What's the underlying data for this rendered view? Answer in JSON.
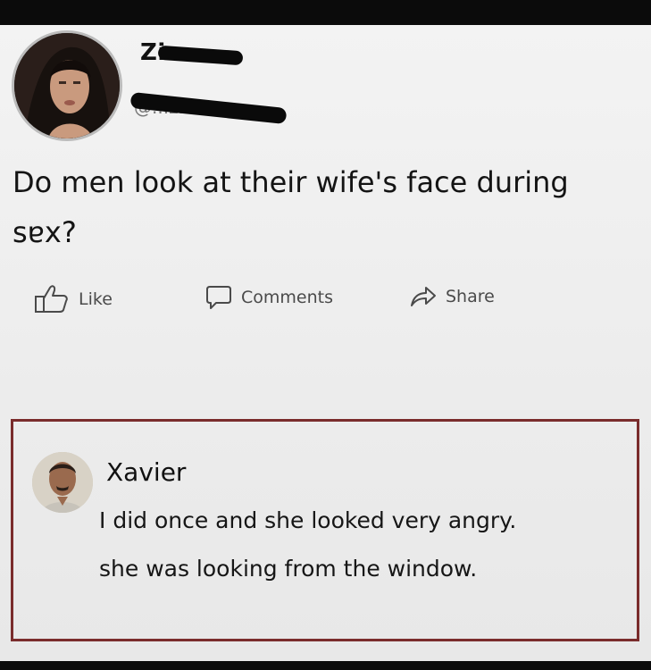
{
  "post": {
    "author_name": "Zi",
    "author_handle": "@...zils",
    "text": "Do men look at their wife's face during sex?",
    "text_line1": "Do men look at their wife's face during",
    "text_line2": "sɐx?"
  },
  "actions": {
    "like_label": "Like",
    "comments_label": "Comments",
    "share_label": "Share"
  },
  "comment": {
    "author_name": "Xavier",
    "line1": "I did once and she looked very angry.",
    "line2": "she was looking from the window."
  },
  "colors": {
    "highlight_border": "#7a2c2c",
    "background": "#f0f0f0",
    "text": "#141414",
    "action_text": "#4a4a4a"
  },
  "icons": {
    "like": "thumbs-up-icon",
    "comments": "speech-bubble-icon",
    "share": "share-arrow-icon"
  }
}
